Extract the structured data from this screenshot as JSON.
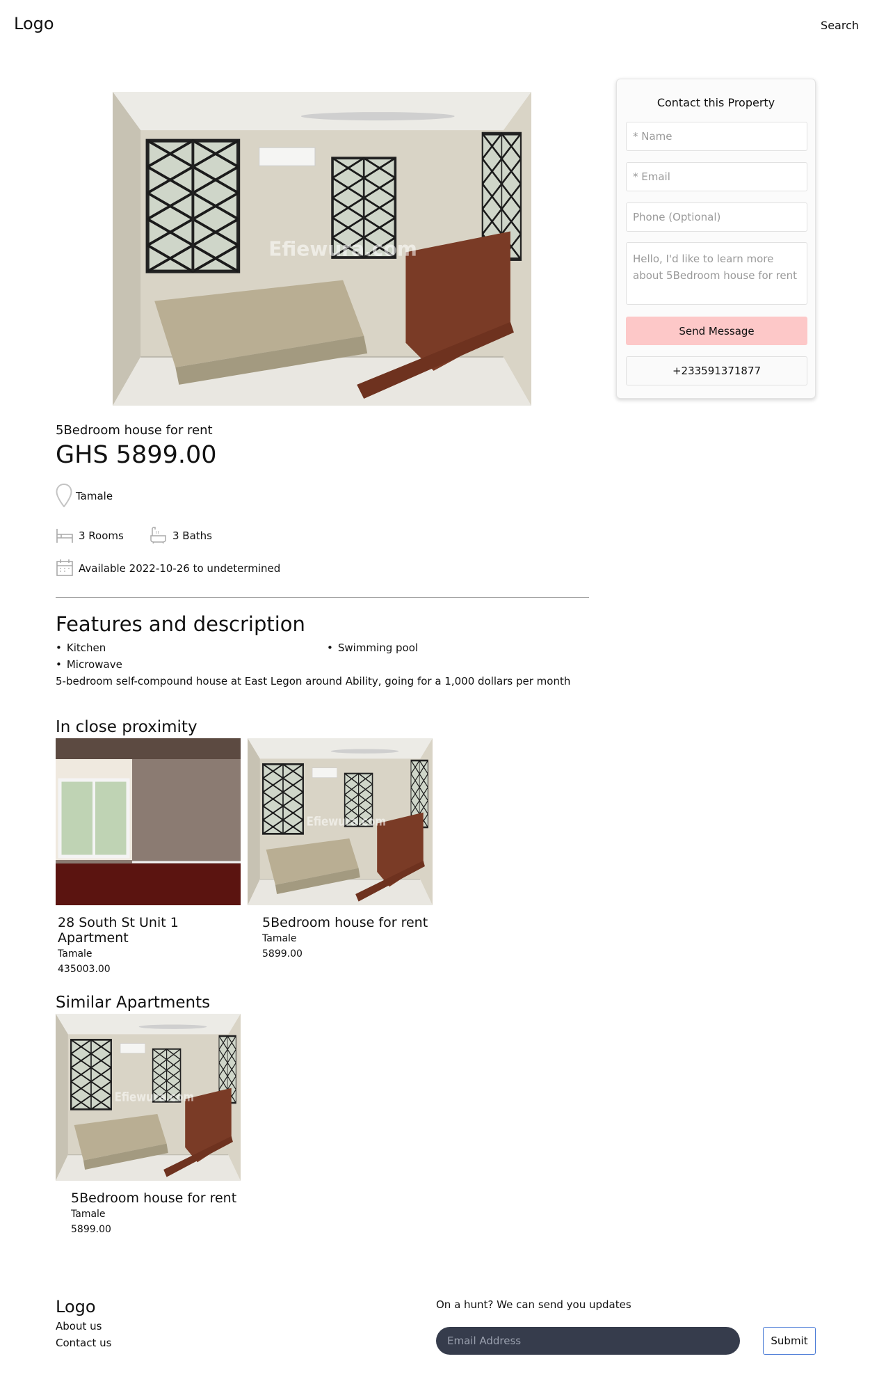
{
  "header": {
    "logo": "Logo",
    "search_label": "Search"
  },
  "contact": {
    "title": "Contact this Property",
    "name_placeholder": "* Name",
    "email_placeholder": "* Email",
    "phone_placeholder": "Phone (Optional)",
    "message_placeholder": "Hello, I'd like to learn more about 5Bedroom house for rent",
    "send_label": "Send Message",
    "phone_number": "+233591371877",
    "send_color": "#fdc8c8"
  },
  "property": {
    "title": "5Bedroom house for rent",
    "price": "GHS 5899.00",
    "location": "Tamale",
    "rooms": "3 Rooms",
    "baths": "3 Baths",
    "availability": "Available 2022-10-26 to undetermined",
    "image_watermark": "Efiewura.com"
  },
  "features": {
    "heading": "Features and description",
    "items": [
      "Kitchen",
      "Swimming pool",
      "Microwave"
    ],
    "description": "5-bedroom self-compound house at East Legon around Ability, going for a 1,000 dollars per month"
  },
  "proximity": {
    "heading": "In close proximity",
    "cards": [
      {
        "title": "28 South St Unit 1 Apartment",
        "location": "Tamale",
        "price": "435003.00"
      },
      {
        "title": "5Bedroom house for rent",
        "location": "Tamale",
        "price": "5899.00"
      }
    ]
  },
  "similar": {
    "heading": "Similar Apartments",
    "cards": [
      {
        "title": "5Bedroom house for rent",
        "location": "Tamale",
        "price": "5899.00"
      }
    ]
  },
  "footer": {
    "logo": "Logo",
    "about": "About us",
    "contact": "Contact us",
    "newsletter_label": "On a hunt? We can send you updates",
    "email_placeholder": "Email Address",
    "submit_label": "Submit"
  },
  "icons": {
    "location": "location-pin-icon",
    "rooms": "bed-icon",
    "baths": "bath-icon",
    "availability": "calendar-icon"
  }
}
